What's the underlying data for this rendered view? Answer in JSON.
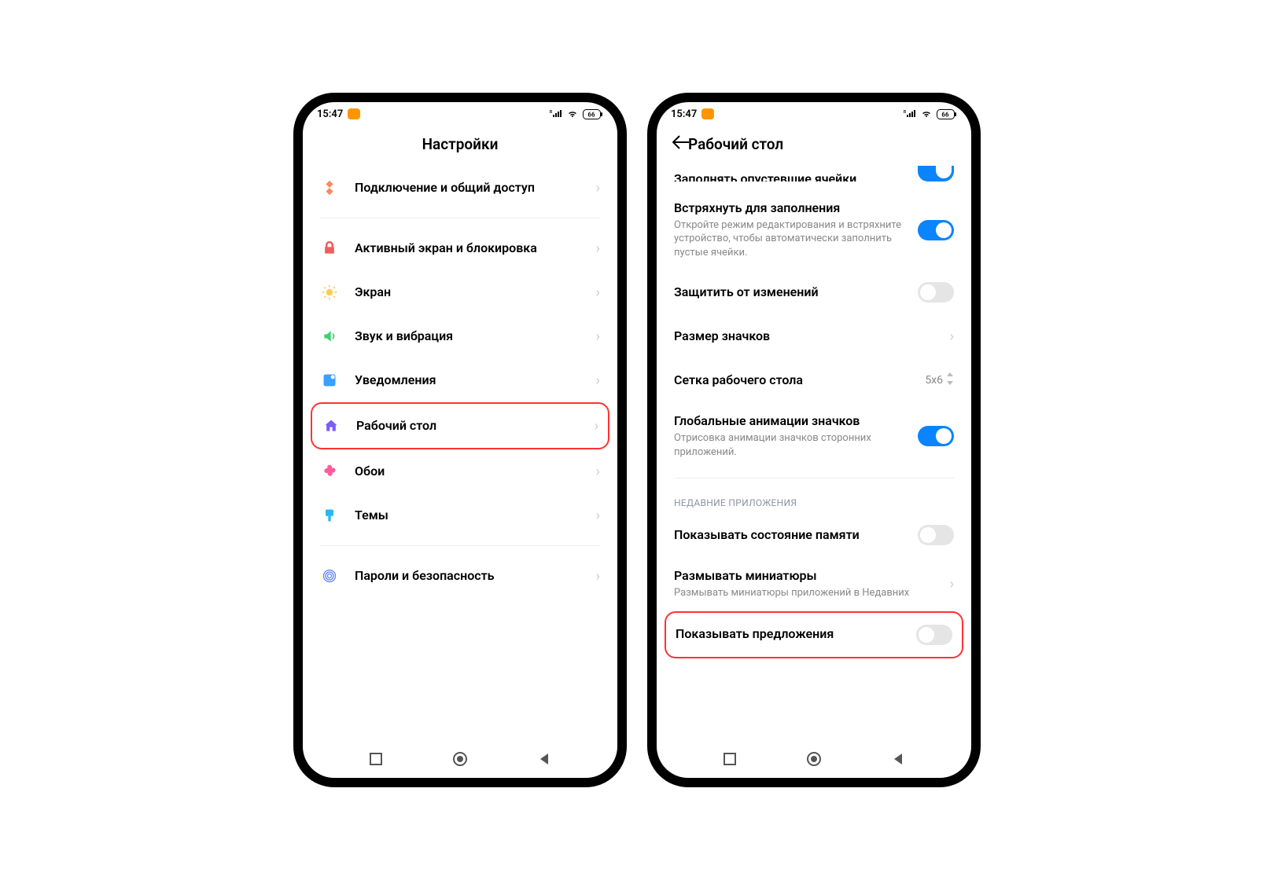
{
  "status": {
    "time": "15:47",
    "battery": "66"
  },
  "left": {
    "title": "Настройки",
    "items": [
      {
        "label": "Подключение и общий доступ"
      },
      {
        "label": "Активный экран и блокировка"
      },
      {
        "label": "Экран"
      },
      {
        "label": "Звук и вибрация"
      },
      {
        "label": "Уведомления"
      },
      {
        "label": "Рабочий стол"
      },
      {
        "label": "Обои"
      },
      {
        "label": "Темы"
      },
      {
        "label": "Пароли и безопасность"
      }
    ]
  },
  "right": {
    "title": "Рабочий стол",
    "cut_top": "Заполнять опустевшие ячейки",
    "items": [
      {
        "label": "Встряхнуть для заполнения",
        "desc": "Откройте режим редактирования и встряхните устройство, чтобы автоматически заполнить пустые ячейки.",
        "kind": "toggle",
        "on": true
      },
      {
        "label": "Защитить от изменений",
        "kind": "toggle",
        "on": false
      },
      {
        "label": "Размер значков",
        "kind": "chevron"
      },
      {
        "label": "Сетка рабочего стола",
        "kind": "value",
        "value": "5x6"
      },
      {
        "label": "Глобальные анимации значков",
        "desc": "Отрисовка анимации значков сторонних приложений.",
        "kind": "toggle",
        "on": true
      }
    ],
    "section": "НЕДАВНИЕ ПРИЛОЖЕНИЯ",
    "items2": [
      {
        "label": "Показывать состояние памяти",
        "kind": "toggle",
        "on": false
      },
      {
        "label": "Размывать миниатюры",
        "desc": "Размывать миниатюры приложений в Недавних",
        "kind": "chevron"
      },
      {
        "label": "Показывать предложения",
        "kind": "toggle",
        "on": false
      }
    ]
  }
}
